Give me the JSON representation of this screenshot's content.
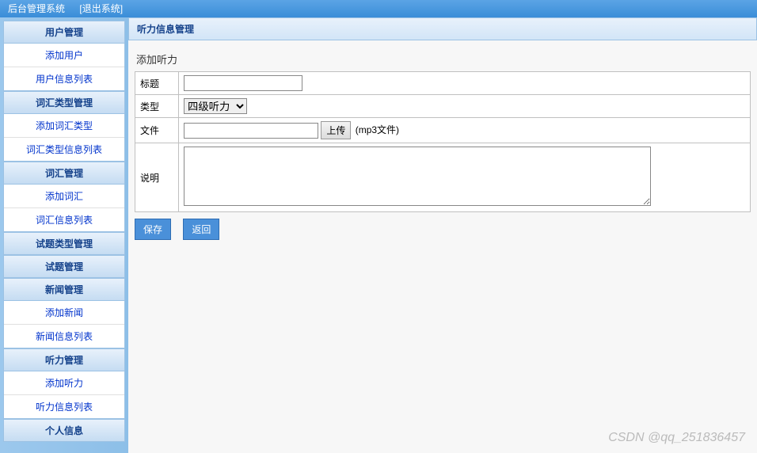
{
  "header": {
    "title": "后台管理系统",
    "logout": "[退出系统]"
  },
  "sidebar": {
    "groups": [
      {
        "title": "用户管理",
        "items": [
          "添加用户",
          "用户信息列表"
        ]
      },
      {
        "title": "词汇类型管理",
        "items": [
          "添加词汇类型",
          "词汇类型信息列表"
        ]
      },
      {
        "title": "词汇管理",
        "items": [
          "添加词汇",
          "词汇信息列表"
        ]
      },
      {
        "title": "试题类型管理",
        "items": []
      },
      {
        "title": "试题管理",
        "items": []
      },
      {
        "title": "新闻管理",
        "items": [
          "添加新闻",
          "新闻信息列表"
        ]
      },
      {
        "title": "听力管理",
        "items": [
          "添加听力",
          "听力信息列表"
        ]
      },
      {
        "title": "个人信息",
        "items": []
      }
    ]
  },
  "main": {
    "panel_title": "听力信息管理",
    "form_subtitle": "添加听力",
    "fields": {
      "title_label": "标题",
      "title_value": "",
      "type_label": "类型",
      "type_selected": "四级听力",
      "file_label": "文件",
      "file_value": "",
      "upload_btn": "上传",
      "file_hint": "(mp3文件)",
      "desc_label": "说明",
      "desc_value": ""
    },
    "buttons": {
      "save": "保存",
      "back": "返回"
    }
  },
  "watermark": "CSDN @qq_251836457"
}
